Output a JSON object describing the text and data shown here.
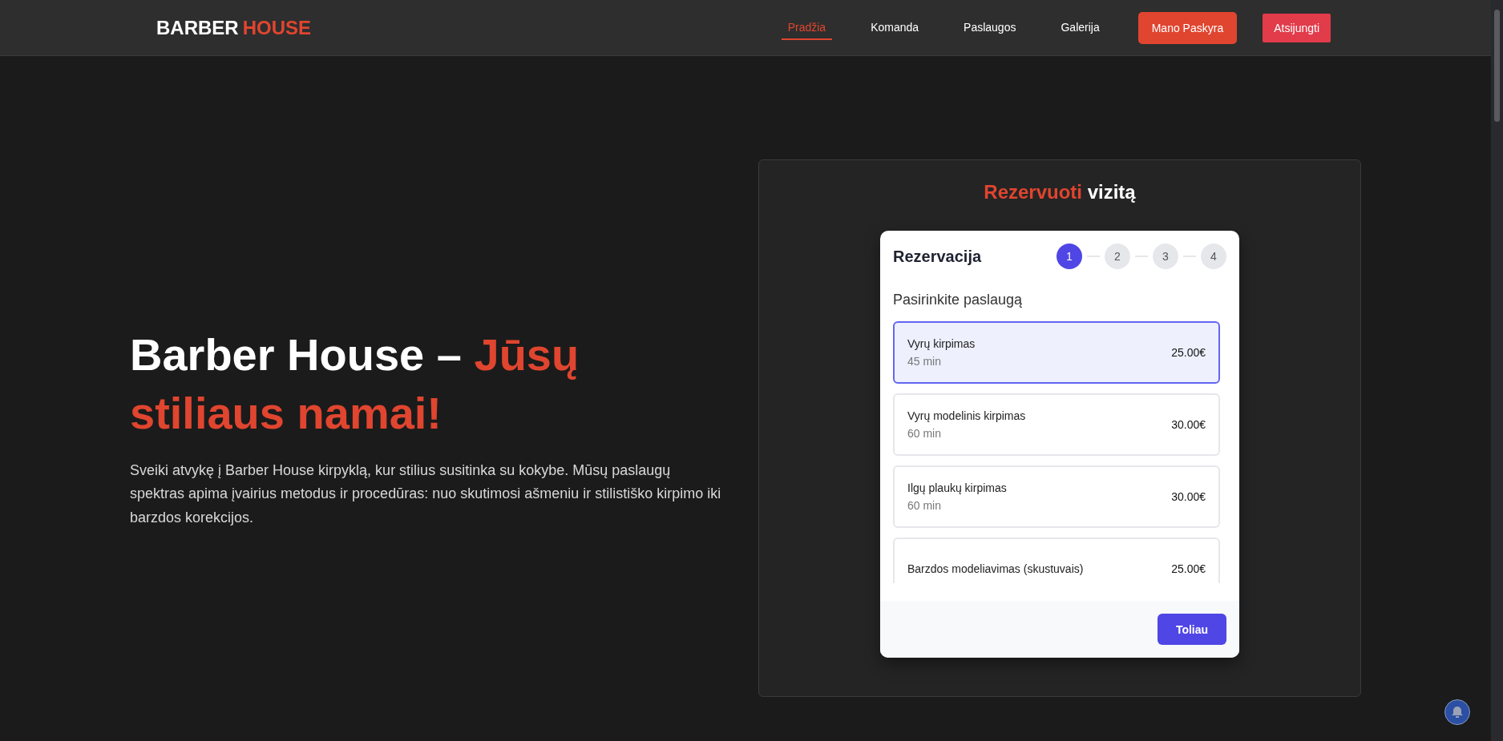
{
  "header": {
    "logo": {
      "first": "BARBER",
      "second": "HOUSE"
    },
    "nav": [
      {
        "label": "Pradžia",
        "selected": true
      },
      {
        "label": "Komanda",
        "selected": false
      },
      {
        "label": "Paslaugos",
        "selected": false
      },
      {
        "label": "Galerija",
        "selected": false
      }
    ],
    "buttons": [
      {
        "label": "Mano Paskyra",
        "kind": "primary"
      },
      {
        "label": "Atsijungti",
        "kind": "danger"
      }
    ]
  },
  "hero": {
    "title": "Barber House –",
    "title_accent": "Jūsų stiliaus namai!",
    "text": "Sveiki atvykę į Barber House kirpyklą, kur stilius susitinka su kokybe. Mūsų paslaugų spektras apima įvairius metodus ir procedūras: nuo skutimosi ašmeniu ir stilistiško kirpimo iki barzdos korekcijos."
  },
  "booking": {
    "title_accent": "Rezervuoti",
    "title": "vizitą",
    "card": {
      "title": "Rezervacija",
      "steps": [
        {
          "label": "1",
          "selected": true
        },
        {
          "label": "2",
          "selected": false
        },
        {
          "label": "3",
          "selected": false
        },
        {
          "label": "4",
          "selected": false
        }
      ],
      "subtitle": "Pasirinkite paslaugą",
      "services": [
        {
          "name": "Vyrų kirpimas",
          "duration": "45 min",
          "price": "25.00€",
          "selected": true
        },
        {
          "name": "Vyrų modelinis kirpimas",
          "duration": "60 min",
          "price": "30.00€",
          "selected": false
        },
        {
          "name": "Ilgų plaukų kirpimas",
          "duration": "60 min",
          "price": "30.00€",
          "selected": false
        },
        {
          "name": "Barzdos modeliavimas (skustuvais)",
          "price": "25.00€",
          "selected": false
        }
      ],
      "next_button": "Toliau"
    }
  }
}
